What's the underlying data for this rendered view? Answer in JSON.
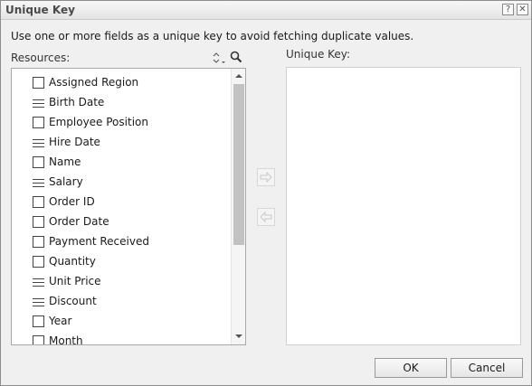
{
  "dialog": {
    "title": "Unique Key",
    "help_glyph": "?",
    "close_glyph": "✕",
    "instruction": "Use one or more fields as a unique key to avoid fetching duplicate values."
  },
  "resources": {
    "label": "Resources:",
    "items": [
      {
        "label": "Assigned Region",
        "icon": "field-checkbox-icon"
      },
      {
        "label": "Birth Date",
        "icon": "measure-lines-icon"
      },
      {
        "label": "Employee Position",
        "icon": "field-checkbox-icon"
      },
      {
        "label": "Hire Date",
        "icon": "measure-lines-icon"
      },
      {
        "label": "Name",
        "icon": "field-checkbox-icon"
      },
      {
        "label": "Salary",
        "icon": "measure-lines-icon"
      },
      {
        "label": "Order ID",
        "icon": "field-checkbox-icon"
      },
      {
        "label": "Order Date",
        "icon": "field-checkbox-icon"
      },
      {
        "label": "Payment Received",
        "icon": "field-checkbox-icon"
      },
      {
        "label": "Quantity",
        "icon": "field-checkbox-icon"
      },
      {
        "label": "Unit Price",
        "icon": "measure-lines-icon"
      },
      {
        "label": "Discount",
        "icon": "measure-lines-icon"
      },
      {
        "label": "Year",
        "icon": "field-checkbox-icon"
      },
      {
        "label": "Month",
        "icon": "field-checkbox-icon"
      }
    ]
  },
  "unique_key": {
    "label": "Unique Key:",
    "items": []
  },
  "footer": {
    "ok_label": "OK",
    "cancel_label": "Cancel"
  }
}
